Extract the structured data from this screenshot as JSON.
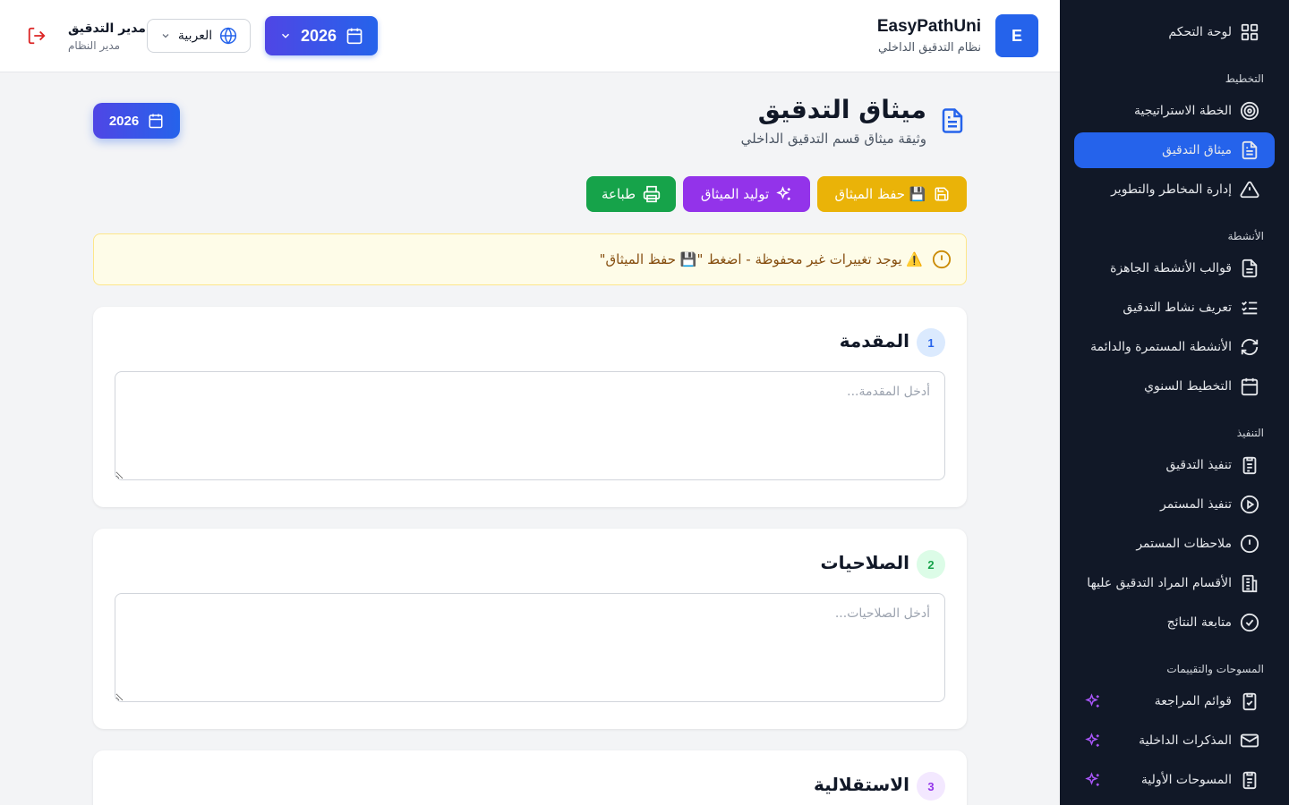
{
  "header": {
    "logo_letter": "E",
    "brand_name": "EasyPathUni",
    "brand_subtitle": "نظام التدقيق الداخلي",
    "year": "2026",
    "language": "العربية",
    "user_name": "مدير التدقيق",
    "user_role": "مدير النظام"
  },
  "sidebar": {
    "dashboard": "لوحة التحكم",
    "section_planning": "التخطيط",
    "strategic_plan": "الخطة الاستراتيجية",
    "audit_charter": "ميثاق التدقيق",
    "risk_management": "إدارة المخاطر والتطوير",
    "section_activities": "الأنشطة",
    "activity_templates": "قوالب الأنشطة الجاهزة",
    "define_activity": "تعريف نشاط التدقيق",
    "continuous_activities": "الأنشطة المستمرة والدائمة",
    "annual_planning": "التخطيط السنوي",
    "section_execution": "التنفيذ",
    "audit_execution": "تنفيذ التدقيق",
    "continuous_execution": "تنفيذ المستمر",
    "continuous_notes": "ملاحظات المستمر",
    "audited_departments": "الأقسام المراد التدقيق عليها",
    "results_followup": "متابعة النتائج",
    "section_surveys": "المسوحات والتقييمات",
    "checklists": "قوائم المراجعة",
    "internal_memos": "المذكرات الداخلية",
    "initial_surveys": "المسوحات الأولية"
  },
  "page": {
    "title": "ميثاق التدقيق",
    "subtitle": "وثيقة ميثاق قسم التدقيق الداخلي",
    "year_badge": "2026"
  },
  "actions": {
    "save": "💾 حفظ الميثاق",
    "generate": "توليد الميثاق",
    "print": "طباعة"
  },
  "alert": {
    "message": "⚠️ يوجد تغييرات غير محفوظة - اضغط \"💾 حفظ الميثاق\""
  },
  "sections": [
    {
      "number": "1",
      "title": "المقدمة",
      "placeholder": "أدخل المقدمة...",
      "badge_bg": "#dbeafe",
      "badge_color": "#2563eb"
    },
    {
      "number": "2",
      "title": "الصلاحيات",
      "placeholder": "أدخل الصلاحيات...",
      "badge_bg": "#dcfce7",
      "badge_color": "#16a34a"
    },
    {
      "number": "3",
      "title": "الاستقلالية",
      "placeholder": "",
      "badge_bg": "#f3e8ff",
      "badge_color": "#9333ea"
    }
  ],
  "colors": {
    "primary": "#2563eb",
    "sidebar_bg": "#111827",
    "save": "#eab308",
    "generate": "#9333ea",
    "print": "#16a34a",
    "logout": "#dc2626"
  }
}
